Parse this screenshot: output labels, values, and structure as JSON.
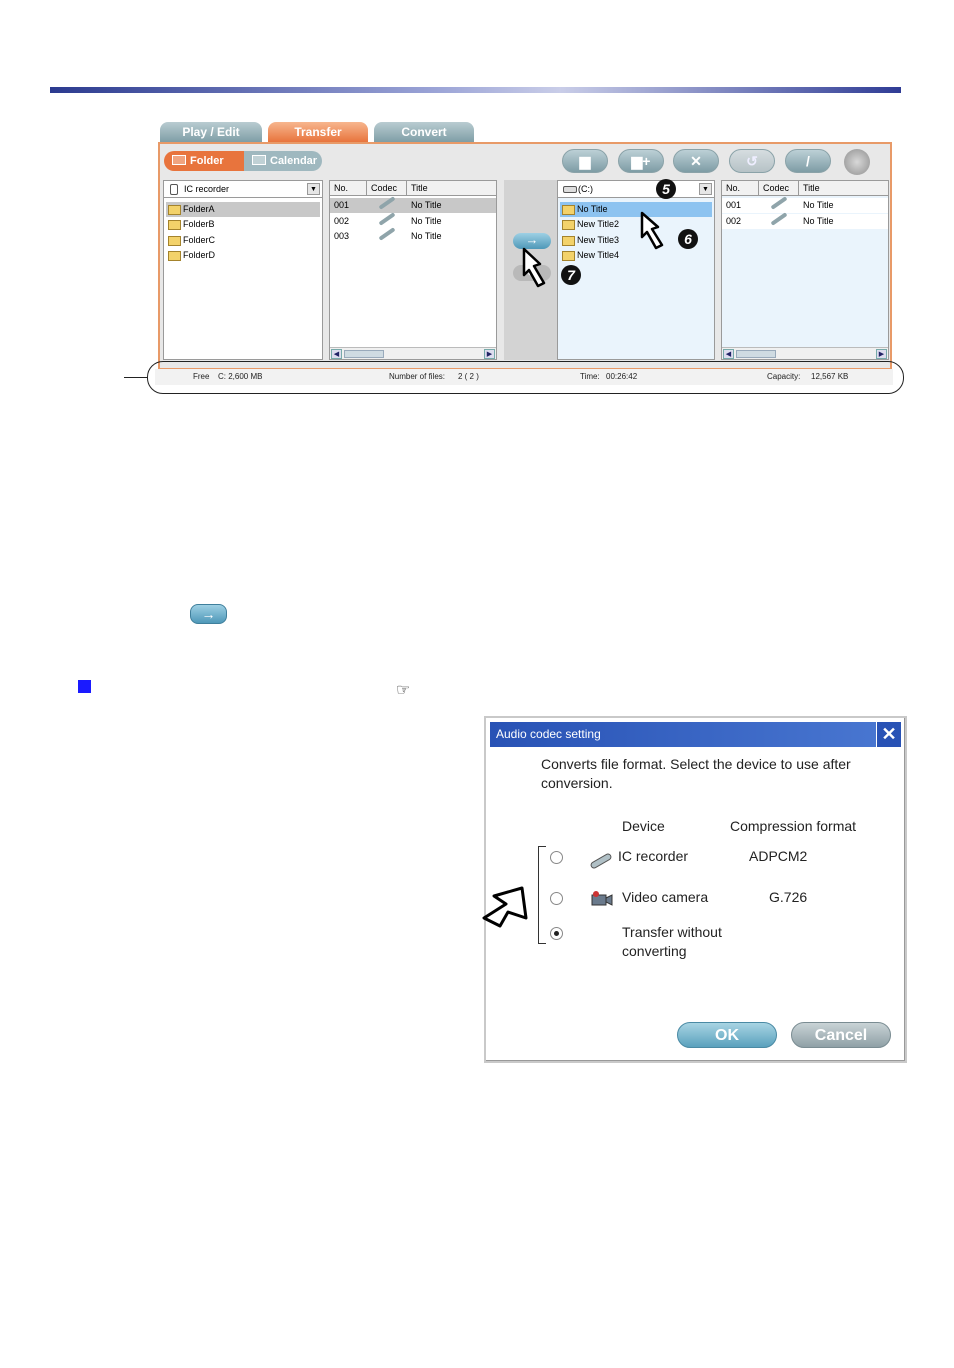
{
  "tabs": [
    "Play / Edit",
    "Transfer",
    "Convert"
  ],
  "view_toggle": {
    "folder": "Folder",
    "calendar": "Calendar"
  },
  "left_device": {
    "name": "IC recorder",
    "folders": [
      "FolderA",
      "FolderB",
      "FolderC",
      "FolderD"
    ]
  },
  "left_table": {
    "headers": [
      "No.",
      "Codec",
      "Title"
    ],
    "rows": [
      {
        "no": "001",
        "title": "No Title"
      },
      {
        "no": "002",
        "title": "No Title"
      },
      {
        "no": "003",
        "title": "No Title"
      }
    ]
  },
  "right_drive": {
    "name": "(C:)",
    "folders": [
      "No Title",
      "New Title2",
      "New Title3",
      "New Title4"
    ]
  },
  "right_table": {
    "headers": [
      "No.",
      "Codec",
      "Title"
    ],
    "rows": [
      {
        "no": "001",
        "title": "No Title"
      },
      {
        "no": "002",
        "title": "No Title"
      }
    ]
  },
  "transfer_buttons": {
    "right": "→",
    "left": "←"
  },
  "status": {
    "free_label": "Free",
    "free_value": "C: 2,600 MB",
    "files_label": "Number of files:",
    "files_value": "2 ( 2 )",
    "time_label": "Time:",
    "time_value": "00:26:42",
    "capacity_label": "Capacity:",
    "capacity_value": "12,567 KB"
  },
  "markers": {
    "m5": "5",
    "m6": "6",
    "m7": "7"
  },
  "inline_button": "→",
  "reference_icon": "☞",
  "dialog": {
    "title": "Audio codec setting",
    "close": "✕",
    "message": "Converts file format. Select the device to use after conversion.",
    "col_device": "Device",
    "col_format": "Compression format",
    "options": [
      {
        "device": "IC recorder",
        "format": "ADPCM2"
      },
      {
        "device": "Video camera",
        "format": "G.726"
      },
      {
        "device": "Transfer without converting",
        "format": ""
      }
    ],
    "ok": "OK",
    "cancel": "Cancel"
  }
}
